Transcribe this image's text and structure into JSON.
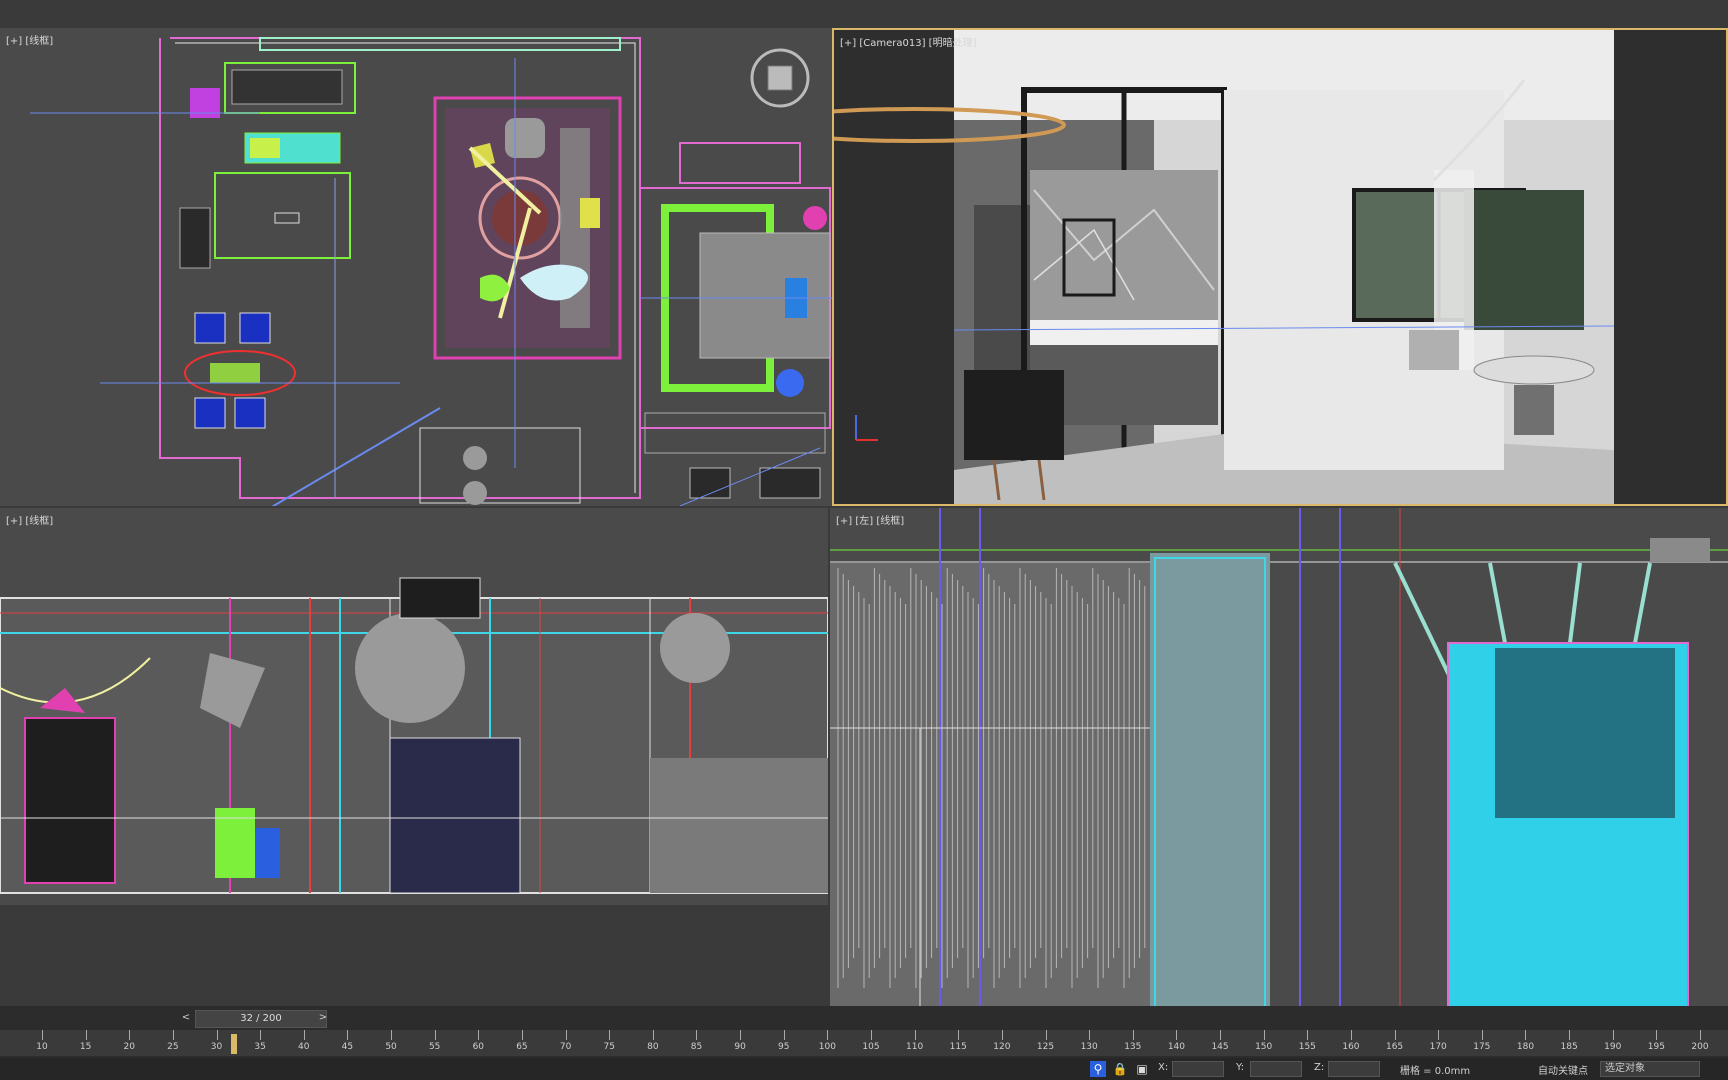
{
  "viewports": {
    "top": {
      "label": "[+] [线框]"
    },
    "camera": {
      "label": "[+] [Camera013] [明暗处理]"
    },
    "front": {
      "label": "[+] [线框]"
    },
    "left": {
      "label": "[+] [左] [线框]"
    }
  },
  "timeline": {
    "frame_display": "32 / 200",
    "current_frame": 32,
    "total_frames": 200,
    "prev_label": "<",
    "next_label": ">",
    "ticks": [
      "10",
      "15",
      "20",
      "25",
      "30",
      "35",
      "40",
      "45",
      "50",
      "55",
      "60",
      "65",
      "70",
      "75",
      "80",
      "85",
      "90",
      "95",
      "100",
      "105",
      "110",
      "115",
      "120",
      "125",
      "130",
      "135",
      "140",
      "145",
      "150",
      "155",
      "160",
      "165",
      "170",
      "175",
      "180",
      "185",
      "190",
      "195",
      "200"
    ]
  },
  "status": {
    "x_label": "X:",
    "y_label": "Y:",
    "z_label": "Z:",
    "grid_text": "栅格 = 0.0mm",
    "auto_key": "自动关键点",
    "selected_set": "选定对象"
  },
  "colors": {
    "active_border": "#d9b86a",
    "viewport_bg": "#4a4a4a",
    "cyan": "#3fd6e8",
    "magenta": "#e040b0",
    "green": "#7cf03a"
  }
}
